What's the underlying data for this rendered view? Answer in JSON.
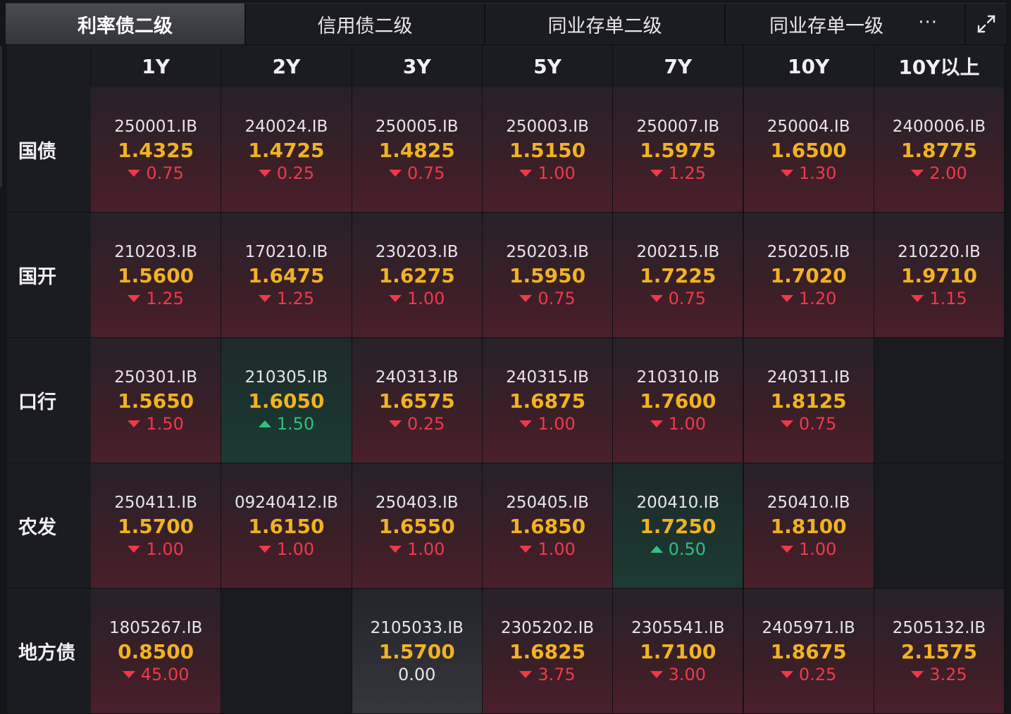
{
  "tabs": [
    {
      "label": "利率债二级",
      "active": true
    },
    {
      "label": "信用债二级",
      "active": false
    },
    {
      "label": "同业存单二级",
      "active": false
    },
    {
      "label": "同业存单一级",
      "active": false
    }
  ],
  "toolbar": {
    "more_label": "···",
    "expand_icon": "expand-icon"
  },
  "columns": [
    "1Y",
    "2Y",
    "3Y",
    "5Y",
    "7Y",
    "10Y",
    "10Y以上"
  ],
  "rows": [
    {
      "label": "国债",
      "cells": [
        {
          "code": "250001.IB",
          "yield": "1.4325",
          "change": "0.75",
          "dir": "down"
        },
        {
          "code": "240024.IB",
          "yield": "1.4725",
          "change": "0.25",
          "dir": "down"
        },
        {
          "code": "250005.IB",
          "yield": "1.4825",
          "change": "0.75",
          "dir": "down"
        },
        {
          "code": "250003.IB",
          "yield": "1.5150",
          "change": "1.00",
          "dir": "down"
        },
        {
          "code": "250007.IB",
          "yield": "1.5975",
          "change": "1.25",
          "dir": "down"
        },
        {
          "code": "250004.IB",
          "yield": "1.6500",
          "change": "1.30",
          "dir": "down"
        },
        {
          "code": "2400006.IB",
          "yield": "1.8775",
          "change": "2.00",
          "dir": "down"
        }
      ]
    },
    {
      "label": "国开",
      "cells": [
        {
          "code": "210203.IB",
          "yield": "1.5600",
          "change": "1.25",
          "dir": "down"
        },
        {
          "code": "170210.IB",
          "yield": "1.6475",
          "change": "1.25",
          "dir": "down"
        },
        {
          "code": "230203.IB",
          "yield": "1.6275",
          "change": "1.00",
          "dir": "down"
        },
        {
          "code": "250203.IB",
          "yield": "1.5950",
          "change": "0.75",
          "dir": "down"
        },
        {
          "code": "200215.IB",
          "yield": "1.7225",
          "change": "0.75",
          "dir": "down"
        },
        {
          "code": "250205.IB",
          "yield": "1.7020",
          "change": "1.20",
          "dir": "down"
        },
        {
          "code": "210220.IB",
          "yield": "1.9710",
          "change": "1.15",
          "dir": "down"
        }
      ]
    },
    {
      "label": "口行",
      "cells": [
        {
          "code": "250301.IB",
          "yield": "1.5650",
          "change": "1.50",
          "dir": "down"
        },
        {
          "code": "210305.IB",
          "yield": "1.6050",
          "change": "1.50",
          "dir": "up"
        },
        {
          "code": "240313.IB",
          "yield": "1.6575",
          "change": "0.25",
          "dir": "down"
        },
        {
          "code": "240315.IB",
          "yield": "1.6875",
          "change": "1.00",
          "dir": "down"
        },
        {
          "code": "210310.IB",
          "yield": "1.7600",
          "change": "1.00",
          "dir": "down"
        },
        {
          "code": "240311.IB",
          "yield": "1.8125",
          "change": "0.75",
          "dir": "down"
        },
        null
      ]
    },
    {
      "label": "农发",
      "cells": [
        {
          "code": "250411.IB",
          "yield": "1.5700",
          "change": "1.00",
          "dir": "down"
        },
        {
          "code": "09240412.IB",
          "yield": "1.6150",
          "change": "1.00",
          "dir": "down"
        },
        {
          "code": "250403.IB",
          "yield": "1.6550",
          "change": "1.00",
          "dir": "down"
        },
        {
          "code": "250405.IB",
          "yield": "1.6850",
          "change": "1.00",
          "dir": "down"
        },
        {
          "code": "200410.IB",
          "yield": "1.7250",
          "change": "0.50",
          "dir": "up"
        },
        {
          "code": "250410.IB",
          "yield": "1.8100",
          "change": "1.00",
          "dir": "down"
        },
        null
      ]
    },
    {
      "label": "地方债",
      "cells": [
        {
          "code": "1805267.IB",
          "yield": "0.8500",
          "change": "45.00",
          "dir": "down"
        },
        null,
        {
          "code": "2105033.IB",
          "yield": "1.5700",
          "change": "0.00",
          "dir": "flat"
        },
        {
          "code": "2305202.IB",
          "yield": "1.6825",
          "change": "3.75",
          "dir": "down"
        },
        {
          "code": "2305541.IB",
          "yield": "1.7100",
          "change": "3.00",
          "dir": "down"
        },
        {
          "code": "2405971.IB",
          "yield": "1.8675",
          "change": "0.25",
          "dir": "down"
        },
        {
          "code": "2505132.IB",
          "yield": "2.1575",
          "change": "3.25",
          "dir": "down"
        }
      ]
    }
  ]
}
